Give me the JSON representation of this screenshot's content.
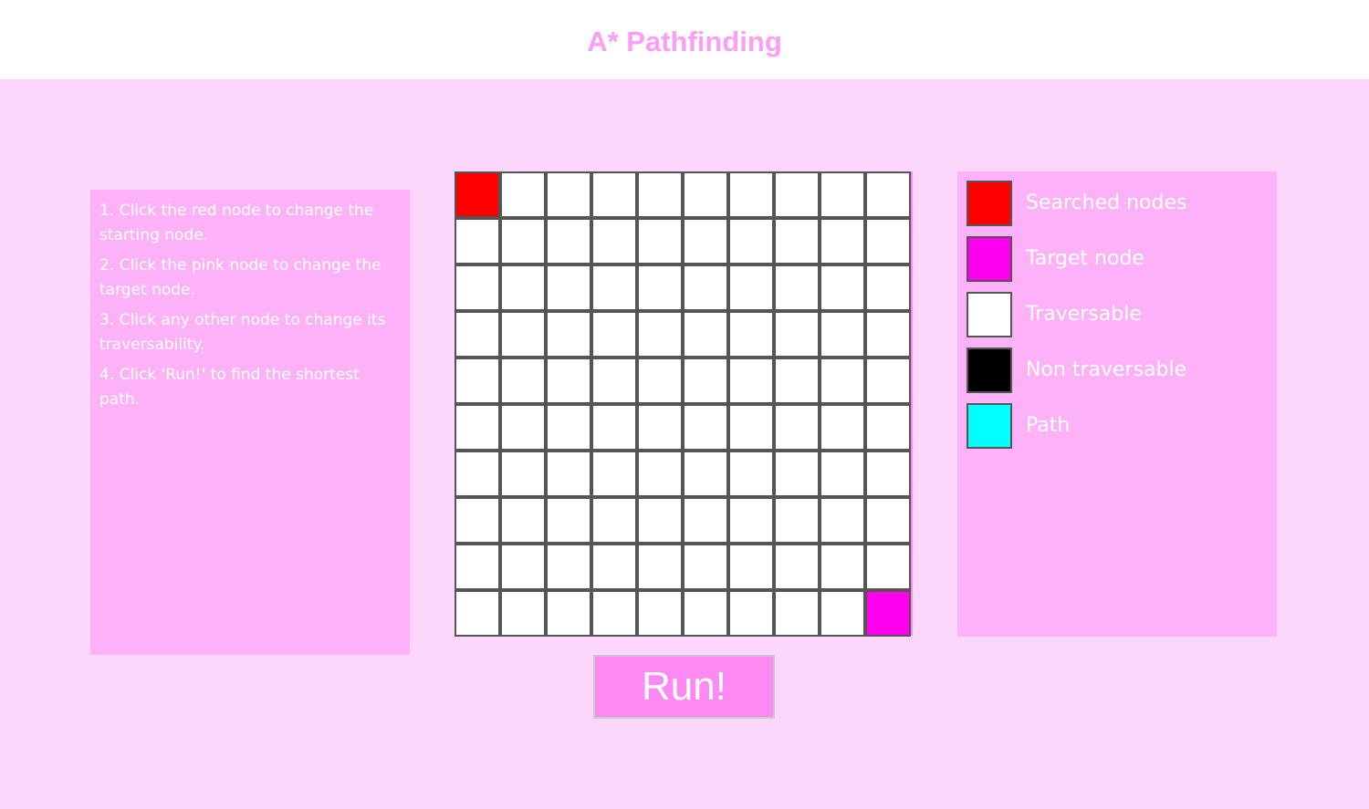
{
  "header": {
    "title": "A* Pathfinding"
  },
  "instructions": [
    "1. Click the red node to change the starting node.",
    "2. Click the pink node to change the target node.",
    "3. Click any other node to change its traversability.",
    "4. Click 'Run!' to find the shortest path."
  ],
  "grid": {
    "rows": 10,
    "cols": 10,
    "start": {
      "row": 0,
      "col": 0
    },
    "target": {
      "row": 9,
      "col": 9
    }
  },
  "run_button": {
    "label": "Run!"
  },
  "legend": [
    {
      "label": "Searched nodes",
      "color": "#ff0000",
      "icon": "searched-swatch"
    },
    {
      "label": "Target node",
      "color": "#ff00ee",
      "icon": "target-swatch"
    },
    {
      "label": "Traversable",
      "color": "#ffffff",
      "icon": "traversable-swatch"
    },
    {
      "label": "Non traversable",
      "color": "#000000",
      "icon": "non-traversable-swatch"
    },
    {
      "label": "Path",
      "color": "#00ffff",
      "icon": "path-swatch"
    }
  ],
  "colors": {
    "title": "#fc9ef5",
    "background": "#fdd6fb",
    "panel": "#fdb2f7",
    "button": "#fd8af3"
  }
}
